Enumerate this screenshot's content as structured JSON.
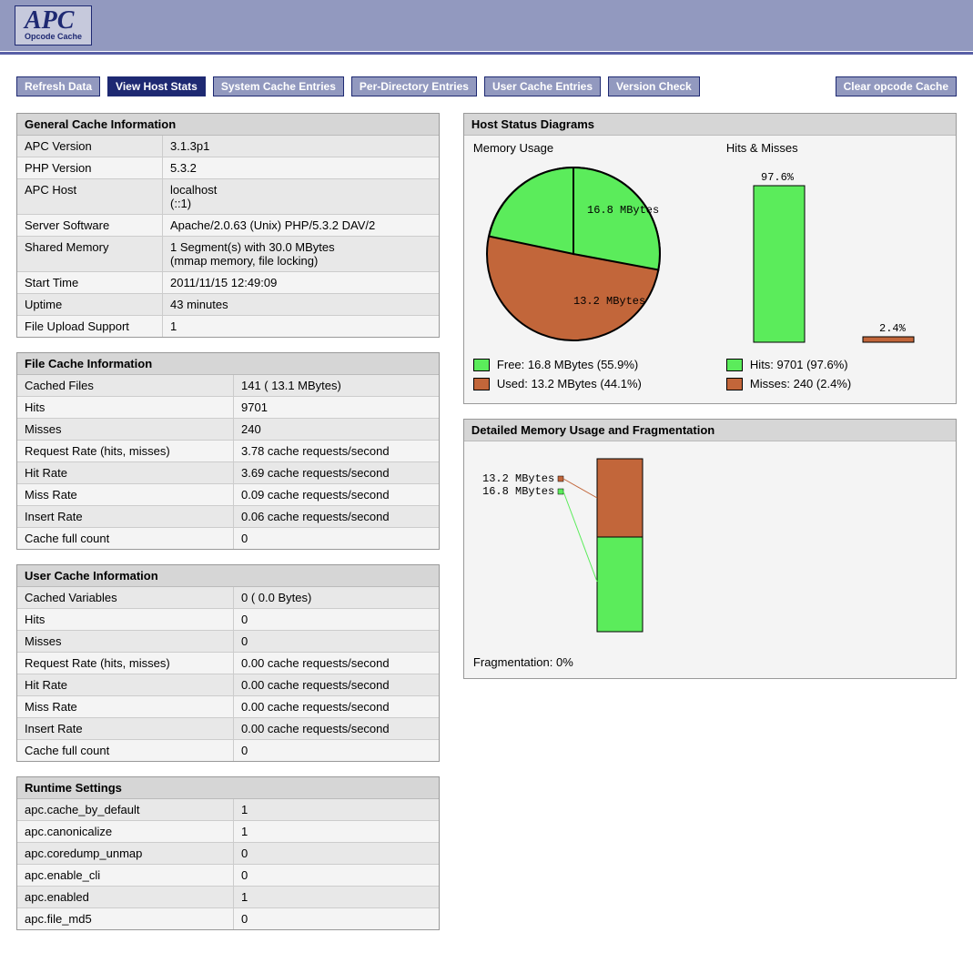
{
  "logo": {
    "title": "APC",
    "subtitle": "Opcode Cache"
  },
  "nav": {
    "refresh": "Refresh Data",
    "view_host_stats": "View Host Stats",
    "system_cache_entries": "System Cache Entries",
    "per_directory_entries": "Per-Directory Entries",
    "user_cache_entries": "User Cache Entries",
    "version_check": "Version Check",
    "clear_opcode_cache": "Clear opcode Cache"
  },
  "panels": {
    "general": {
      "title": "General Cache Information",
      "rows": [
        {
          "k": "APC Version",
          "v": "3.1.3p1"
        },
        {
          "k": "PHP Version",
          "v": "5.3.2"
        },
        {
          "k": "APC Host",
          "v": "localhost\n(::1)"
        },
        {
          "k": "Server Software",
          "v": "Apache/2.0.63 (Unix) PHP/5.3.2 DAV/2"
        },
        {
          "k": "Shared Memory",
          "v": "1 Segment(s) with 30.0 MBytes\n(mmap memory, file locking)"
        },
        {
          "k": "Start Time",
          "v": "2011/11/15 12:49:09"
        },
        {
          "k": "Uptime",
          "v": "43 minutes"
        },
        {
          "k": "File Upload Support",
          "v": "1"
        }
      ]
    },
    "filecache": {
      "title": "File Cache Information",
      "rows": [
        {
          "k": "Cached Files",
          "v": "141 ( 13.1 MBytes)"
        },
        {
          "k": "Hits",
          "v": "9701"
        },
        {
          "k": "Misses",
          "v": "240"
        },
        {
          "k": "Request Rate (hits, misses)",
          "v": "3.78 cache requests/second"
        },
        {
          "k": "Hit Rate",
          "v": "3.69 cache requests/second"
        },
        {
          "k": "Miss Rate",
          "v": "0.09 cache requests/second"
        },
        {
          "k": "Insert Rate",
          "v": "0.06 cache requests/second"
        },
        {
          "k": "Cache full count",
          "v": "0"
        }
      ]
    },
    "usercache": {
      "title": "User Cache Information",
      "rows": [
        {
          "k": "Cached Variables",
          "v": "0 ( 0.0 Bytes)"
        },
        {
          "k": "Hits",
          "v": "0"
        },
        {
          "k": "Misses",
          "v": "0"
        },
        {
          "k": "Request Rate (hits, misses)",
          "v": "0.00 cache requests/second"
        },
        {
          "k": "Hit Rate",
          "v": "0.00 cache requests/second"
        },
        {
          "k": "Miss Rate",
          "v": "0.00 cache requests/second"
        },
        {
          "k": "Insert Rate",
          "v": "0.00 cache requests/second"
        },
        {
          "k": "Cache full count",
          "v": "0"
        }
      ]
    },
    "runtime": {
      "title": "Runtime Settings",
      "rows": [
        {
          "k": "apc.cache_by_default",
          "v": "1"
        },
        {
          "k": "apc.canonicalize",
          "v": "1"
        },
        {
          "k": "apc.coredump_unmap",
          "v": "0"
        },
        {
          "k": "apc.enable_cli",
          "v": "0"
        },
        {
          "k": "apc.enabled",
          "v": "1"
        },
        {
          "k": "apc.file_md5",
          "v": "0"
        }
      ]
    }
  },
  "diagrams": {
    "title": "Host Status Diagrams",
    "memory": {
      "label": "Memory Usage",
      "free_label": "16.8 MBytes",
      "used_label": "13.2 MBytes",
      "legend_free": "Free: 16.8 MBytes (55.9%)",
      "legend_used": "Used: 13.2 MBytes (44.1%)"
    },
    "hits": {
      "label": "Hits & Misses",
      "hit_pct": "97.6%",
      "miss_pct": "2.4%",
      "legend_hits": "Hits: 9701 (97.6%)",
      "legend_misses": "Misses: 240 (2.4%)"
    }
  },
  "fragmentation": {
    "title": "Detailed Memory Usage and Fragmentation",
    "used_label": "13.2 MBytes",
    "free_label": "16.8 MBytes",
    "text": "Fragmentation: 0%"
  },
  "chart_data": [
    {
      "type": "pie",
      "title": "Memory Usage",
      "series": [
        {
          "name": "Free",
          "value": 16.8,
          "pct": 55.9,
          "unit": "MBytes",
          "color": "#5BEC5B"
        },
        {
          "name": "Used",
          "value": 13.2,
          "pct": 44.1,
          "unit": "MBytes",
          "color": "#C2663A"
        }
      ]
    },
    {
      "type": "bar",
      "title": "Hits & Misses",
      "categories": [
        "Hits",
        "Misses"
      ],
      "values": [
        9701,
        240
      ],
      "pct": [
        97.6,
        2.4
      ],
      "colors": [
        "#5BEC5B",
        "#C2663A"
      ],
      "ylim": [
        0,
        100
      ]
    },
    {
      "type": "bar",
      "title": "Detailed Memory Usage and Fragmentation",
      "categories": [
        "Used",
        "Free"
      ],
      "values": [
        13.2,
        16.8
      ],
      "unit": "MBytes",
      "colors": [
        "#C2663A",
        "#5BEC5B"
      ],
      "fragmentation_pct": 0
    }
  ]
}
